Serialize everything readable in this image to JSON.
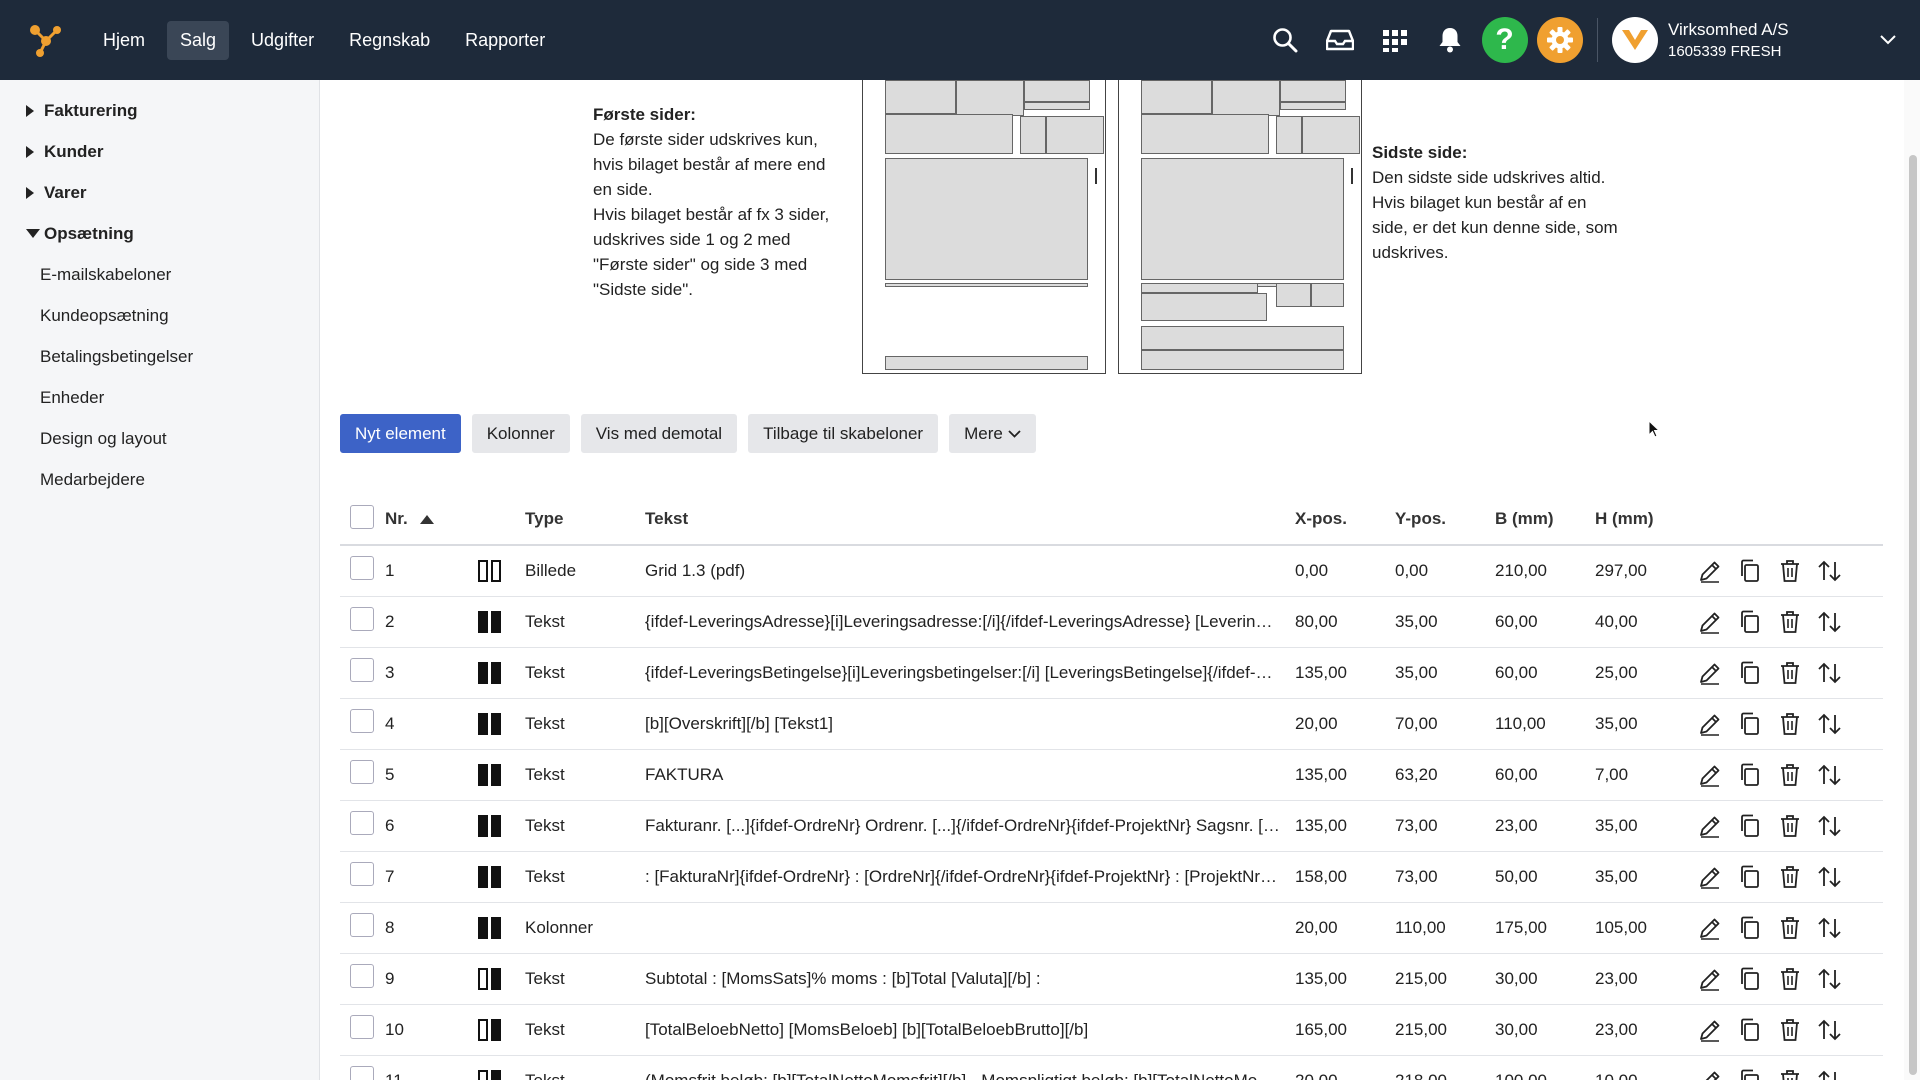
{
  "topbar": {
    "nav": [
      "Hjem",
      "Salg",
      "Udgifter",
      "Regnskab",
      "Rapporter"
    ],
    "active_nav": "Salg",
    "icons": [
      "search-icon",
      "inbox-icon",
      "apps-grid-icon",
      "bell-icon",
      "help-icon",
      "gear-icon"
    ],
    "help_symbol": "?",
    "colors": {
      "bar": "#1e2a3a",
      "help": "#2eb84c",
      "settings": "#f0a030",
      "logo": "#f0a030"
    },
    "company": {
      "name": "Virksomhed A/S",
      "id": "1605339 FRESH"
    }
  },
  "sidebar": {
    "groups": [
      {
        "label": "Fakturering",
        "expanded": false
      },
      {
        "label": "Kunder",
        "expanded": false
      },
      {
        "label": "Varer",
        "expanded": false
      },
      {
        "label": "Opsætning",
        "expanded": true
      }
    ],
    "sub_items": [
      "E-mailskabeloner",
      "Kundeopsætning",
      "Betalingsbetingelser",
      "Enheder",
      "Design og layout",
      "Medarbejdere"
    ]
  },
  "info": {
    "first_title": "Første sider:",
    "first_lines": [
      "De første sider udskrives kun,",
      "hvis bilaget består af mere end",
      "en side.",
      "Hvis bilaget består af fx 3 sider,",
      "udskrives side 1 og 2 med",
      "\"Første sider\" og side 3 med",
      "\"Sidste side\"."
    ],
    "last_title": "Sidste side:",
    "last_lines": [
      "Den sidste side udskrives altid.",
      "Hvis bilaget kun består af en",
      "side, er det kun denne side, som",
      "udskrives."
    ]
  },
  "toolbar": {
    "new_element": "Nyt element",
    "columns": "Kolonner",
    "demo": "Vis med demotal",
    "back": "Tilbage til skabeloner",
    "more": "Mere"
  },
  "table": {
    "headers": {
      "nr": "Nr.",
      "type": "Type",
      "text": "Tekst",
      "x": "X-pos.",
      "y": "Y-pos.",
      "w": "B (mm)",
      "h": "H (mm)"
    },
    "rows": [
      {
        "nr": "1",
        "icon": "first-outline",
        "type": "Billede",
        "text": "Grid 1.3 (pdf)",
        "x": "0,00",
        "y": "0,00",
        "w": "210,00",
        "h": "297,00"
      },
      {
        "nr": "2",
        "icon": "both-filled",
        "type": "Tekst",
        "text": "{ifdef-LeveringsAdresse}[i]Leveringsadresse:[/i]{/ifdef-LeveringsAdresse} [LeveringsAdresse]",
        "x": "80,00",
        "y": "35,00",
        "w": "60,00",
        "h": "40,00"
      },
      {
        "nr": "3",
        "icon": "both-filled",
        "type": "Tekst",
        "text": "{ifdef-LeveringsBetingelse}[i]Leveringsbetingelser:[/i] [LeveringsBetingelse]{/ifdef-LeveringsBetingelse}",
        "x": "135,00",
        "y": "35,00",
        "w": "60,00",
        "h": "25,00"
      },
      {
        "nr": "4",
        "icon": "both-filled",
        "type": "Tekst",
        "text": "[b][Overskrift][/b] [Tekst1]",
        "x": "20,00",
        "y": "70,00",
        "w": "110,00",
        "h": "35,00"
      },
      {
        "nr": "5",
        "icon": "both-filled",
        "type": "Tekst",
        "text": "FAKTURA",
        "x": "135,00",
        "y": "63,20",
        "w": "60,00",
        "h": "7,00"
      },
      {
        "nr": "6",
        "icon": "both-filled",
        "type": "Tekst",
        "text": "Fakturanr. [...]{ifdef-OrdreNr} Ordrenr. [...]{/ifdef-OrdreNr}{ifdef-ProjektNr} Sagsnr. [...]{/ifdef-ProjektNr}",
        "x": "135,00",
        "y": "73,00",
        "w": "23,00",
        "h": "35,00"
      },
      {
        "nr": "7",
        "icon": "both-filled",
        "type": "Tekst",
        "text": ": [FakturaNr]{ifdef-OrdreNr} : [OrdreNr]{/ifdef-OrdreNr}{ifdef-ProjektNr} : [ProjektNr]{/ifdef-ProjektNr}",
        "x": "158,00",
        "y": "73,00",
        "w": "50,00",
        "h": "35,00"
      },
      {
        "nr": "8",
        "icon": "both-filled",
        "type": "Kolonner",
        "text": "",
        "x": "20,00",
        "y": "110,00",
        "w": "175,00",
        "h": "105,00"
      },
      {
        "nr": "9",
        "icon": "last-filled",
        "type": "Tekst",
        "text": "Subtotal : [MomsSats]% moms : [b]Total [Valuta][/b] :",
        "x": "135,00",
        "y": "215,00",
        "w": "30,00",
        "h": "23,00"
      },
      {
        "nr": "10",
        "icon": "last-filled",
        "type": "Tekst",
        "text": "[TotalBeloebNetto] [MomsBeloeb] [b][TotalBeloebBrutto][/b]",
        "x": "165,00",
        "y": "215,00",
        "w": "30,00",
        "h": "23,00"
      },
      {
        "nr": "11",
        "icon": "last-filled",
        "type": "Tekst",
        "text": "(Momsfrit beløb: [b][TotalNettoMomsfrit][/b] - Momspligtigt beløb: [b][TotalNettoMomspligtigt][/b])",
        "x": "20,00",
        "y": "218,00",
        "w": "100,00",
        "h": "10,00"
      }
    ]
  }
}
